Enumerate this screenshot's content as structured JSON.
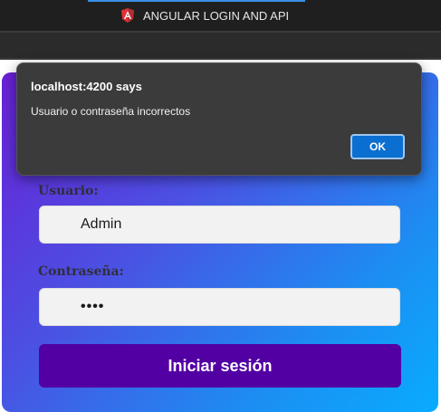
{
  "browser": {
    "tab_title": "ANGULAR LOGIN AND API",
    "tab_icon": "angular-icon"
  },
  "login_form": {
    "user_label": "Usuario:",
    "user_value": "Admin",
    "password_label": "Contraseña:",
    "password_value": "••••",
    "submit_label": "Iniciar sesión"
  },
  "dialog": {
    "title": "localhost:4200 says",
    "message": "Usuario o contraseña incorrectos",
    "ok_label": "OK"
  },
  "colors": {
    "card_gradient_start": "#6a1fd6",
    "card_gradient_end": "#08acff",
    "submit_button": "#5200a3",
    "dialog_background": "#3b3b3b",
    "ok_button": "#0a6fd1"
  }
}
